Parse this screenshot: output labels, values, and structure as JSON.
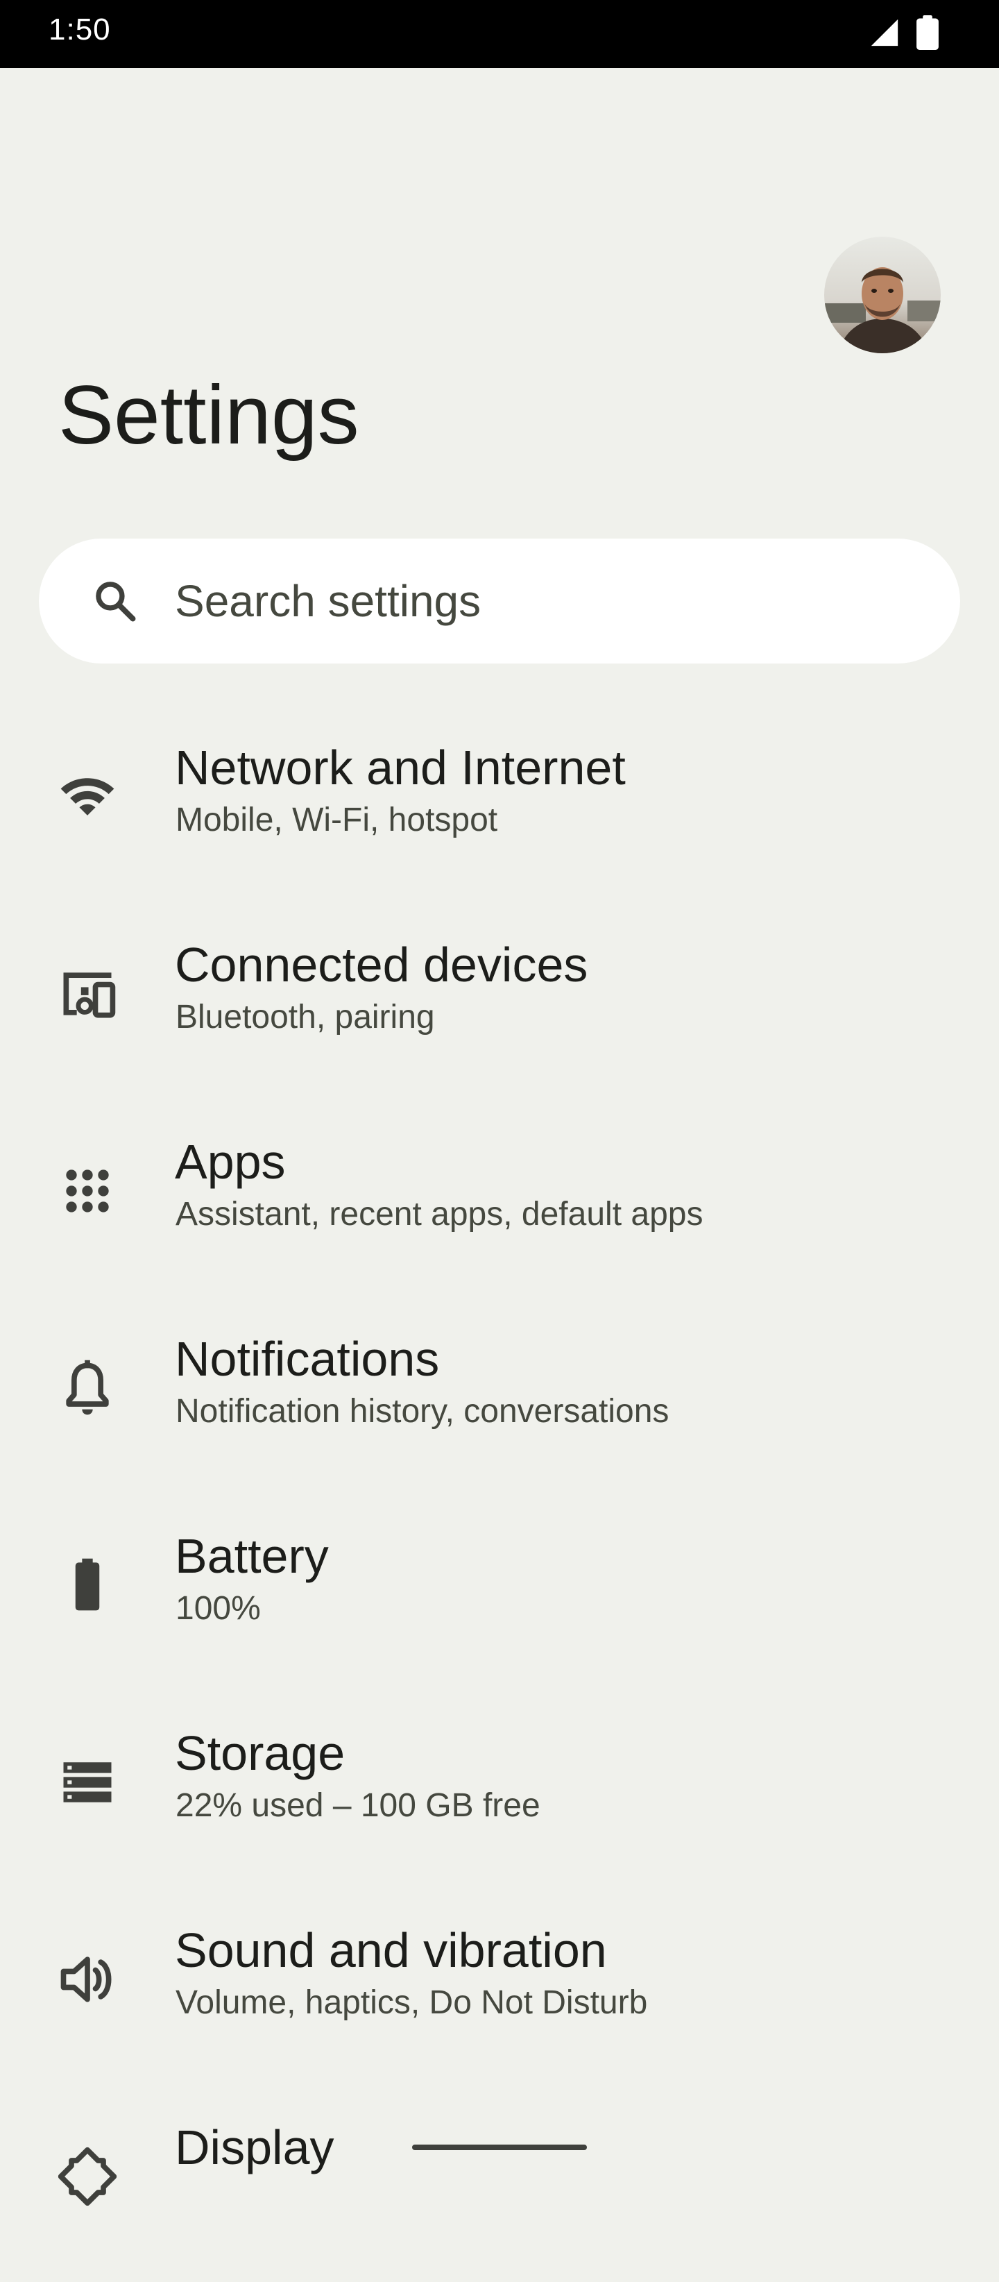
{
  "status_bar": {
    "time": "1:50",
    "icons": [
      "signal-icon",
      "battery-icon"
    ]
  },
  "header": {
    "title": "Settings",
    "avatar": "profile-avatar"
  },
  "search": {
    "placeholder": "Search settings",
    "icon": "search-icon"
  },
  "items": [
    {
      "icon": "wifi-icon",
      "title": "Network and Internet",
      "subtitle": "Mobile, Wi-Fi, hotspot"
    },
    {
      "icon": "devices-icon",
      "title": "Connected devices",
      "subtitle": "Bluetooth, pairing"
    },
    {
      "icon": "apps-grid-icon",
      "title": "Apps",
      "subtitle": "Assistant, recent apps, default apps"
    },
    {
      "icon": "bell-icon",
      "title": "Notifications",
      "subtitle": "Notification history, conversations"
    },
    {
      "icon": "battery-icon",
      "title": "Battery",
      "subtitle": "100%"
    },
    {
      "icon": "storage-icon",
      "title": "Storage",
      "subtitle": "22% used – 100 GB free"
    },
    {
      "icon": "speaker-icon",
      "title": "Sound and vibration",
      "subtitle": "Volume, haptics, Do Not Disturb"
    },
    {
      "icon": "display-icon",
      "title": "Display",
      "subtitle": ""
    }
  ],
  "colors": {
    "background": "#f0f1ec",
    "status_bar": "#000000",
    "search_background": "#ffffff",
    "icon": "#3f403c",
    "title": "#1c1d1a",
    "subtitle": "#45483f"
  }
}
